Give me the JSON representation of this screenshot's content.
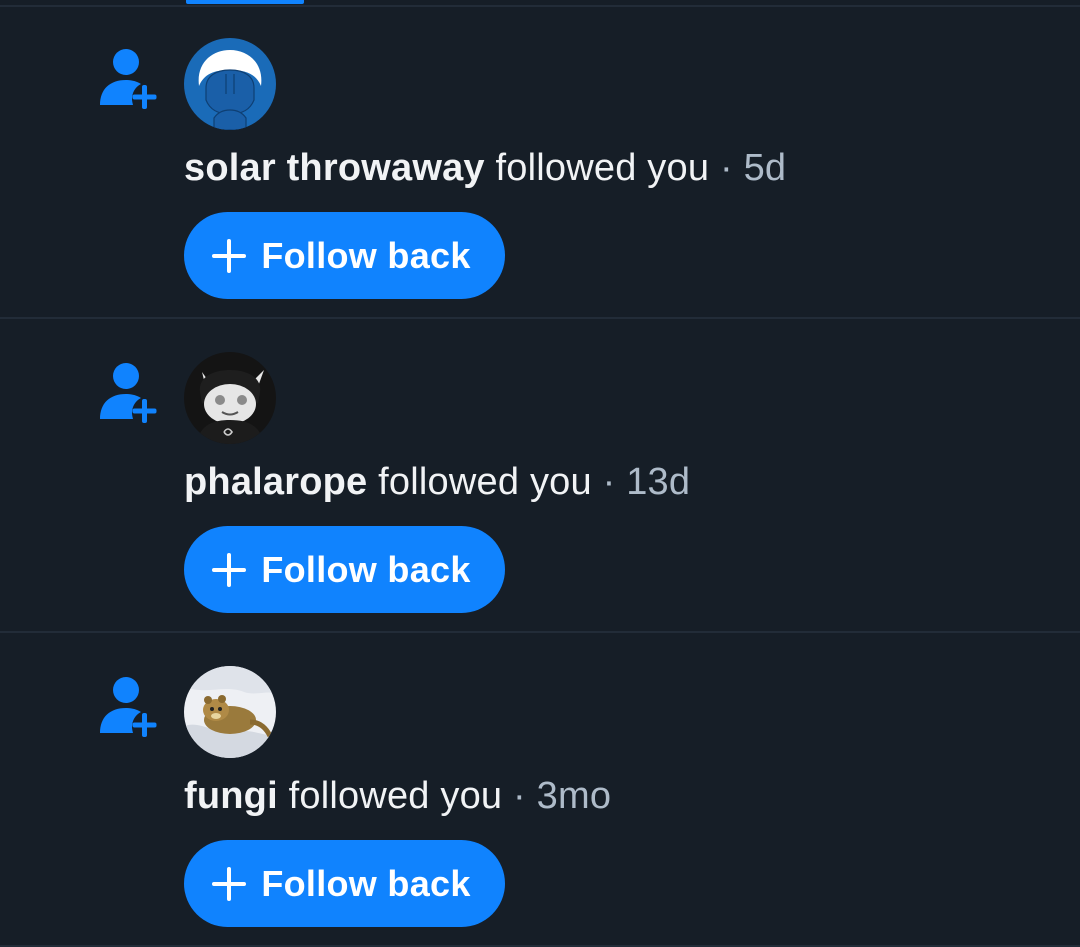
{
  "colors": {
    "background": "#161e27",
    "divider": "#222c38",
    "accent": "#1083fe",
    "text_primary": "#f1f3f5",
    "text_muted": "#aebbc9"
  },
  "notifications": [
    {
      "icon": "person-add-icon",
      "avatar": "avatar-solar-throwaway",
      "name": "solar throwaway",
      "action": "followed you",
      "separator": "·",
      "time": "5d",
      "button_label": "Follow back"
    },
    {
      "icon": "person-add-icon",
      "avatar": "avatar-phalarope",
      "name": "phalarope",
      "action": "followed you",
      "separator": "·",
      "time": "13d",
      "button_label": "Follow back"
    },
    {
      "icon": "person-add-icon",
      "avatar": "avatar-fungi",
      "name": "fungi",
      "action": "followed you",
      "separator": "·",
      "time": "3mo",
      "button_label": "Follow back"
    }
  ]
}
